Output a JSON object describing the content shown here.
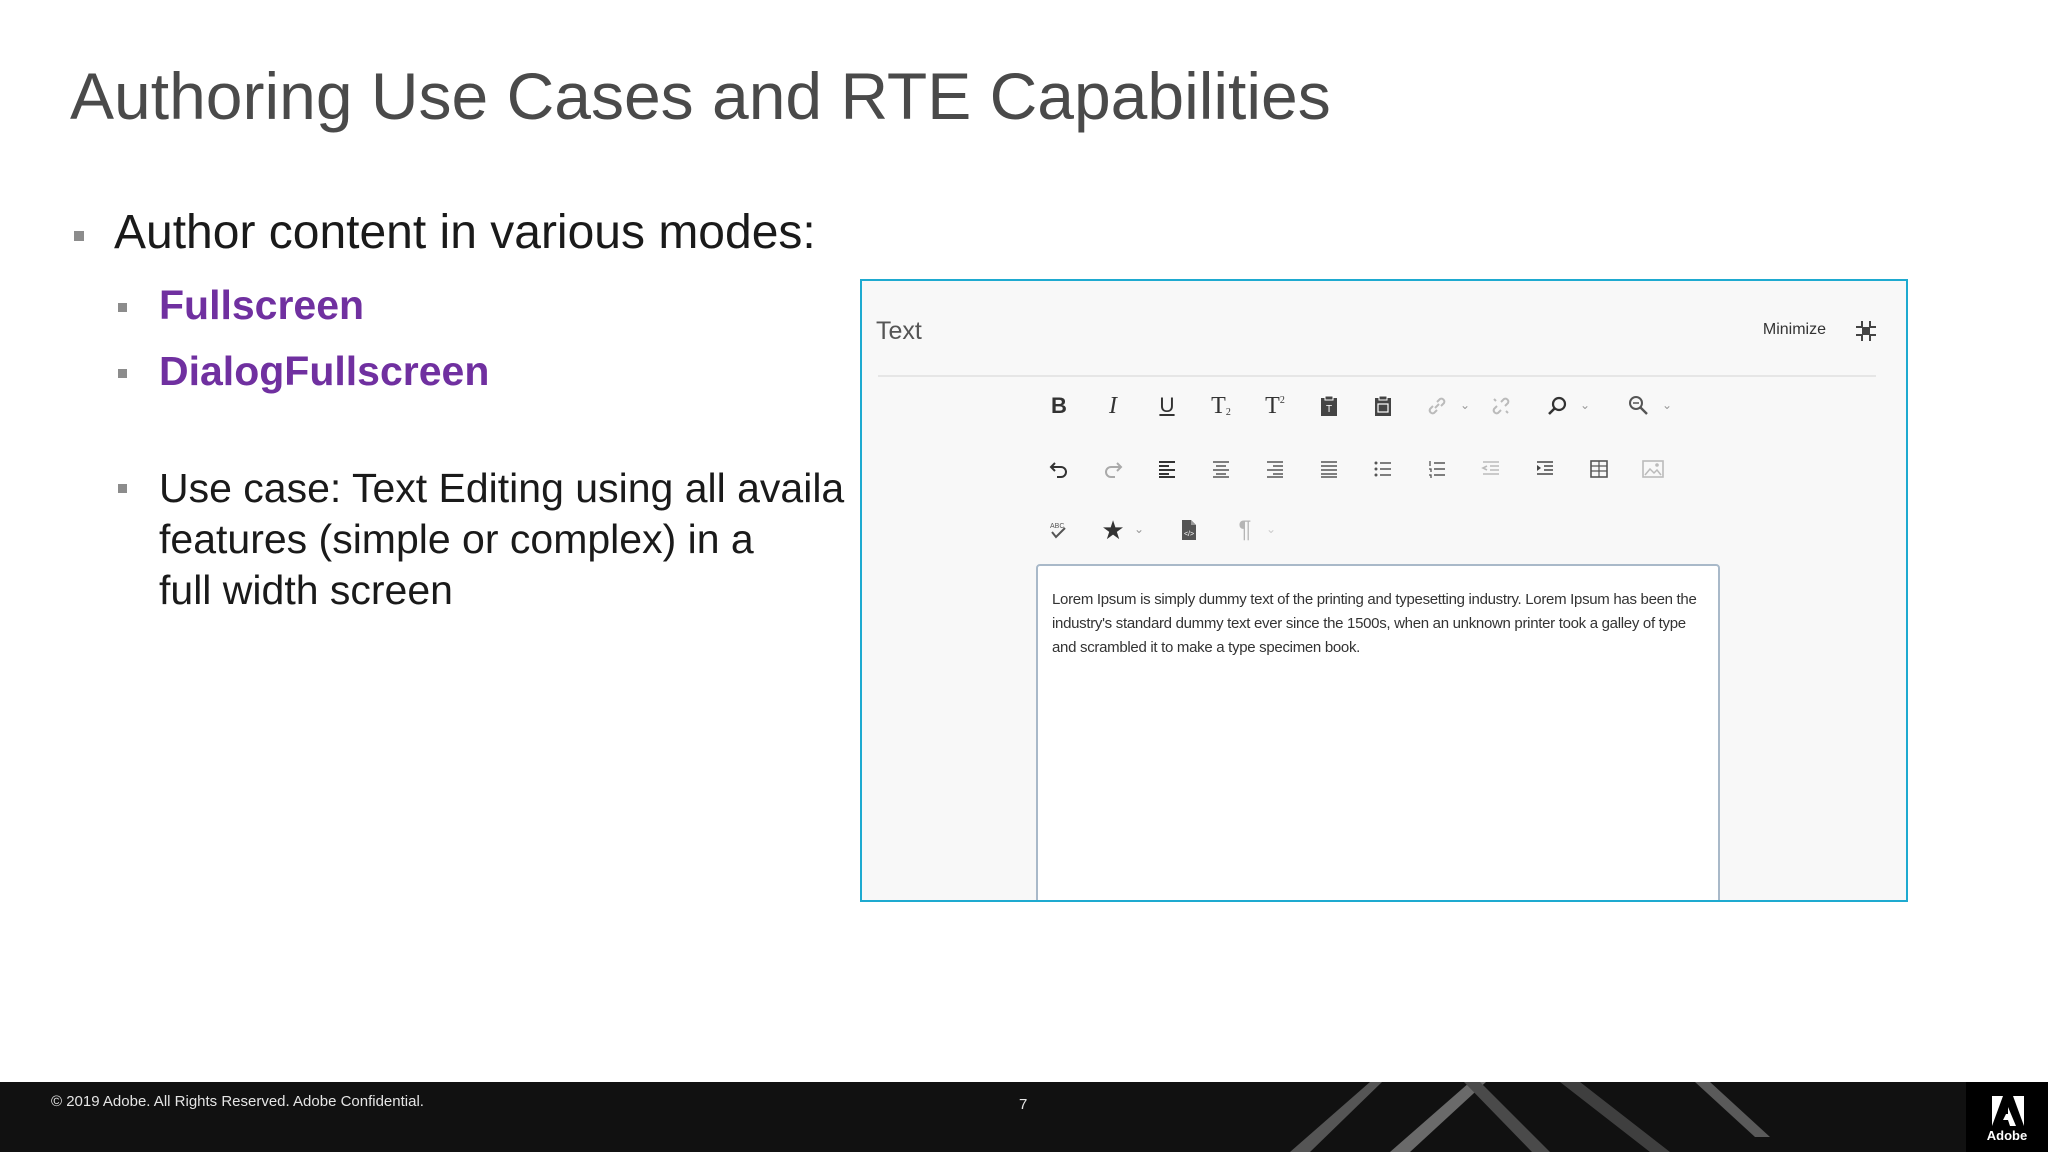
{
  "slide": {
    "title": "Authoring Use Cases and RTE Capabilities",
    "bullets": {
      "main": "Author content in various modes:",
      "modes": [
        "Fullscreen",
        "DialogFullscreen"
      ],
      "use_case_lines": [
        "Use case: Text Editing using all availa",
        "features (simple or complex) in a",
        "full width screen"
      ]
    },
    "colors": {
      "title": "#4a4a4a",
      "highlight": "#7030a0",
      "panel_border": "#1eaad0",
      "footer_bg": "#111111"
    }
  },
  "rte": {
    "title": "Text",
    "minimize_label": "Minimize",
    "toolbar_row1": [
      "bold-icon",
      "italic-icon",
      "underline-icon",
      "subscript-icon",
      "superscript-icon",
      "paste-text-icon",
      "paste-word-icon",
      "link-icon",
      "unlink-icon",
      "find-icon",
      "find-replace-icon"
    ],
    "toolbar_row2": [
      "undo-icon",
      "redo-icon",
      "align-left-icon",
      "align-center-icon",
      "align-right-icon",
      "align-justify-icon",
      "bulleted-list-icon",
      "numbered-list-icon",
      "outdent-icon",
      "indent-icon",
      "table-icon",
      "image-icon"
    ],
    "toolbar_row3": [
      "spellcheck-icon",
      "special-chars-icon",
      "source-edit-icon",
      "paragraph-icon"
    ],
    "editor_text": "Lorem Ipsum is simply dummy text of the printing and typesetting industry. Lorem Ipsum has been the industry's standard dummy text ever since the 1500s, when an unknown printer took a galley of type and scrambled it to make a type specimen book."
  },
  "footer": {
    "copyright": "© 2019 Adobe.  All Rights Reserved.  Adobe Confidential.",
    "page_number": "7",
    "logo_text": "Adobe"
  }
}
